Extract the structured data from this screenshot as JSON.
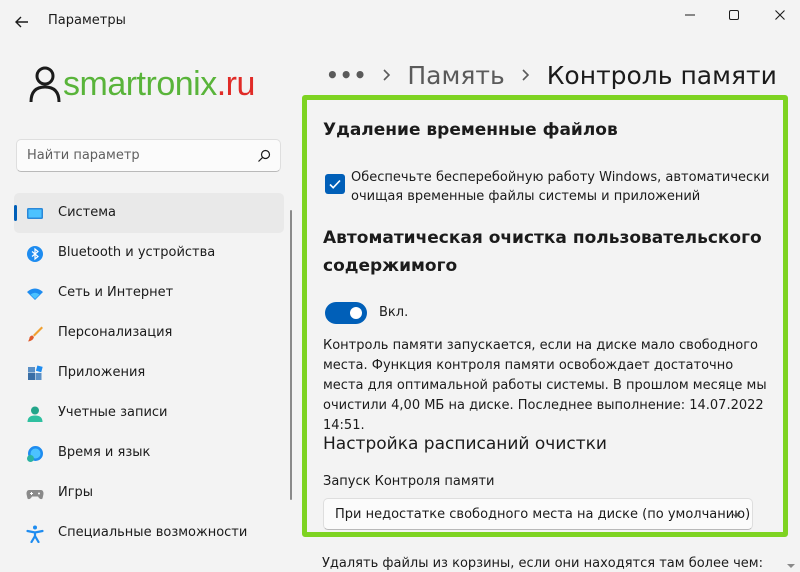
{
  "window": {
    "title": "Параметры"
  },
  "logo": {
    "part1": "smartronix",
    "part2": ".ru"
  },
  "search": {
    "placeholder": "Найти параметр"
  },
  "sidebar": {
    "items": [
      {
        "label": "Система",
        "icon": "system-icon",
        "selected": true
      },
      {
        "label": "Bluetooth и устройства",
        "icon": "bluetooth-icon"
      },
      {
        "label": "Сеть и Интернет",
        "icon": "network-icon"
      },
      {
        "label": "Персонализация",
        "icon": "brush-icon"
      },
      {
        "label": "Приложения",
        "icon": "apps-icon"
      },
      {
        "label": "Учетные записи",
        "icon": "accounts-icon"
      },
      {
        "label": "Время и язык",
        "icon": "time-language-icon"
      },
      {
        "label": "Игры",
        "icon": "gamepad-icon"
      },
      {
        "label": "Специальные возможности",
        "icon": "accessibility-icon"
      }
    ]
  },
  "breadcrumb": {
    "more": "•••",
    "parent": "Память",
    "current": "Контроль памяти"
  },
  "main": {
    "temp_heading": "Удаление временные файлов",
    "temp_checkbox_label": "Обеспечьте бесперебойную работу Windows, автоматически очищая временные файлы системы и приложений",
    "temp_checkbox_checked": true,
    "auto_heading_line1": "Автоматическая очистка пользовательского",
    "auto_heading_line2": "содержимого",
    "toggle_label": "Вкл.",
    "toggle_on": true,
    "description": "Контроль памяти запускается, если на диске мало свободного места. Функция контроля памяти освобождает достаточно места для оптимальной работы системы. В прошлом месяце мы очистили 4,00 МБ на диске. Последнее выполнение: 14.07.2022 14:51.",
    "schedule_heading": "Настройка расписаний очистки",
    "run_label": "Запуск Контроля памяти",
    "run_value": "При недостатке свободного места на диске (по умолчанию)",
    "recycle_label": "Удалять файлы из корзины, если они находятся там более чем:"
  },
  "colors": {
    "accent": "#005fb8",
    "highlight_border": "#7ed321",
    "logo_green": "#59b43a",
    "logo_red": "#e02b27"
  }
}
